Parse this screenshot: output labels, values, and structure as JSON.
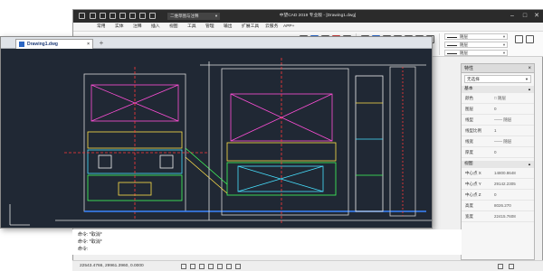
{
  "window": {
    "title": "中望CAD 2019 专业版 - [Drawing1.dwg]",
    "workspace": "二维草图与注释",
    "controls": {
      "minimize": "–",
      "restore": "□",
      "close": "✕"
    }
  },
  "menu": {
    "items": [
      "常用",
      "实体",
      "注释",
      "插入",
      "视图",
      "工具",
      "管理",
      "输出",
      "扩展工具",
      "云服务",
      "APP+"
    ]
  },
  "ribbon": {
    "layer_linetype_1": "随层",
    "layer_linetype_2": "随层",
    "layer_linetype_3": "随层"
  },
  "document": {
    "tab_label": "Drawing1.dwg",
    "tab_close": "×",
    "add_tab": "+"
  },
  "properties_panel": {
    "title": "特性",
    "close": "×",
    "selection": "无选择",
    "general_section": "基本",
    "general_rows": [
      {
        "key": "颜色",
        "value": "□ 随层"
      },
      {
        "key": "图层",
        "value": "0"
      },
      {
        "key": "线型",
        "value": "—— 随层"
      },
      {
        "key": "线型比例",
        "value": "1"
      },
      {
        "key": "线宽",
        "value": "—— 随层"
      },
      {
        "key": "厚度",
        "value": "0"
      }
    ],
    "view_section": "视图",
    "view_rows": [
      {
        "key": "中心点 X",
        "value": "14800.8648"
      },
      {
        "key": "中心点 Y",
        "value": "29142.2305"
      },
      {
        "key": "中心点 Z",
        "value": "0"
      },
      {
        "key": "高度",
        "value": "8026.270"
      },
      {
        "key": "宽度",
        "value": "22415.7608"
      }
    ]
  },
  "command": {
    "line1": "命令: *取消*",
    "line2": "命令: *取消*",
    "prompt": "命令:"
  },
  "status": {
    "coordinates": "22543.4766, 29961.3960, 0.0000"
  },
  "colors": {
    "canvas_bg": "#202834",
    "titlebar": "#2b2b2b",
    "accent": "#2c67c4"
  }
}
